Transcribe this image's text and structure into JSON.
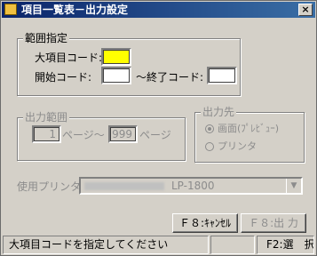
{
  "window": {
    "title": "項目一覧表－出力設定",
    "close_glyph": "×"
  },
  "range_group": {
    "legend": "範囲指定",
    "major_code_label": "大項目コード:",
    "major_code_value": "",
    "start_code_label": "開始コード:",
    "start_code_value": "",
    "end_code_label": "～終了コード:",
    "end_code_value": ""
  },
  "output_range_group": {
    "legend": "出力範囲",
    "from_page": "1",
    "page_label_1": "ページ～",
    "to_page": "999",
    "page_label_2": "ページ"
  },
  "output_dest_group": {
    "legend": "出力先",
    "options": [
      {
        "label": "画面(ﾌﾟﾚﾋﾞｭｰ)",
        "selected": true
      },
      {
        "label": "プリンタ",
        "selected": false
      }
    ]
  },
  "printer": {
    "label": "使用プリンタ",
    "value": "LP-1800"
  },
  "buttons": {
    "cancel": "Ｆ８:ｷｬﾝｾﾙ",
    "output": "Ｆ８:出 力"
  },
  "status_bar": {
    "message": "大項目コードを指定してください",
    "key_hint": "F2:選　択"
  },
  "colors": {
    "highlight_field": "#ffff00",
    "title_bar": "#0a246a"
  }
}
